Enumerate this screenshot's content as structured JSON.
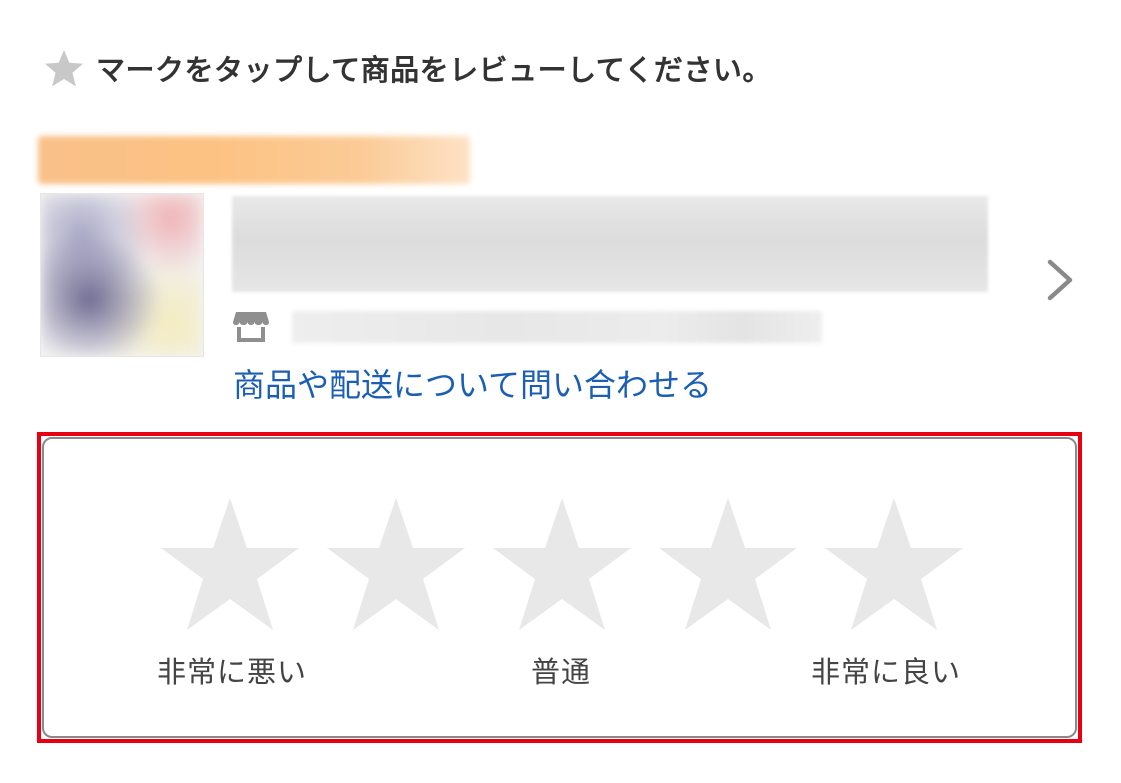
{
  "instruction": {
    "icon": "star-icon",
    "text": "マークをタップして商品をレビューしてください。"
  },
  "product": {
    "store_icon": "store-icon",
    "contact_link": "商品や配送について問い合わせる",
    "detail_icon": "chevron-right-icon"
  },
  "rating": {
    "max_stars": 5,
    "selected": 0,
    "star_color": "#e8e8e8",
    "labels": {
      "low": "非常に悪い",
      "mid": "普通",
      "high": "非常に良い"
    }
  },
  "colors": {
    "highlight": "#e60012",
    "link": "#1b5fb4",
    "icon_gray": "#c8c8c8"
  }
}
